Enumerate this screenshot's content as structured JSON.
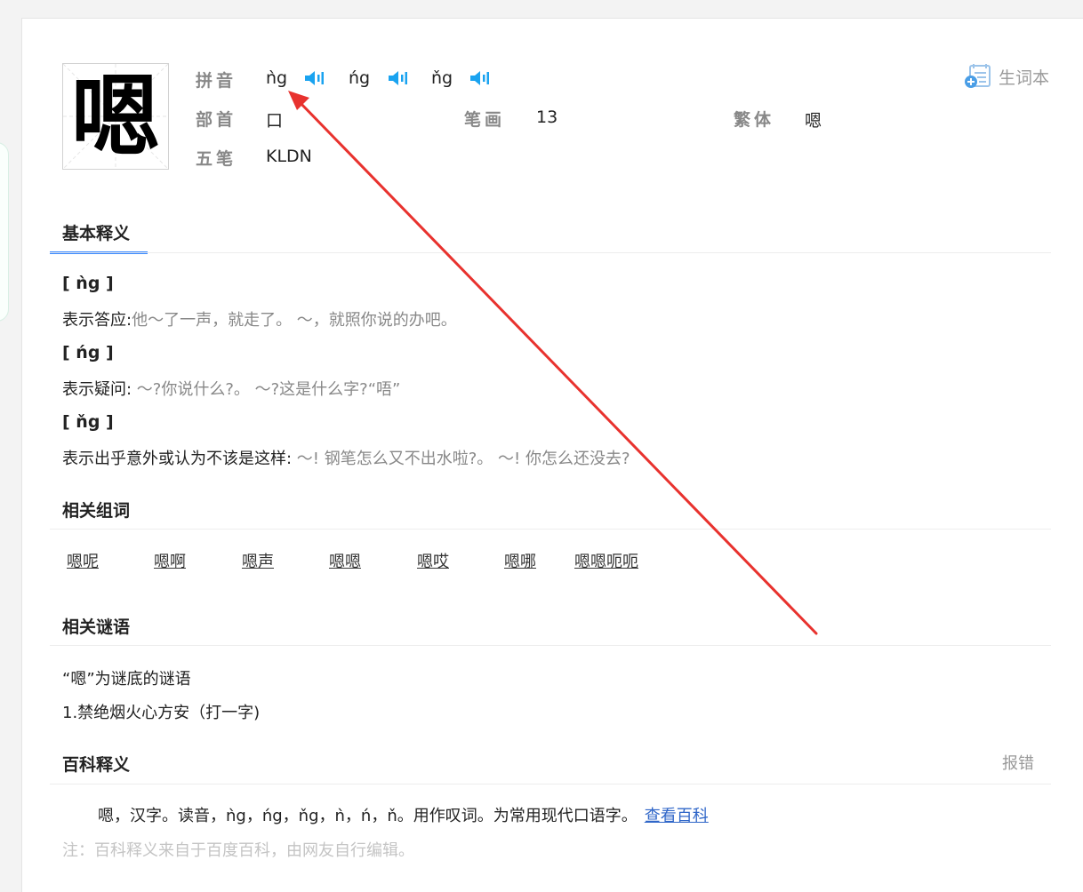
{
  "character": {
    "glyph": "嗯",
    "pinyin_label": "拼音",
    "readings": [
      {
        "text": "ǹg"
      },
      {
        "text": "ńg"
      },
      {
        "text": "ňg"
      }
    ],
    "radical_label": "部首",
    "radical": "口",
    "strokes_label": "笔画",
    "strokes": "13",
    "traditional_label": "繁体",
    "traditional": "嗯",
    "wubi_label": "五笔",
    "wubi": "KLDN",
    "vocab_label": "生词本"
  },
  "basic": {
    "title": "基本释义",
    "entries": [
      {
        "pinyin": "[ ǹg ]",
        "meaning": "表示答应:",
        "examples": "他～了一声，就走了。 ～，就照你说的办吧。"
      },
      {
        "pinyin": "[ ńg ]",
        "meaning": "表示疑问:",
        "examples": " ～?你说什么?。 ～?这是什么字?“唔”"
      },
      {
        "pinyin": "[ ňg ]",
        "meaning": "表示出乎意外或认为不该是这样:",
        "examples": " ～! 钢笔怎么又不出水啦?。 ～! 你怎么还没去?"
      }
    ]
  },
  "related_words": {
    "title": "相关组词",
    "words": [
      "嗯呢",
      "嗯啊",
      "嗯声",
      "嗯嗯",
      "嗯哎",
      "嗯哪",
      "嗯嗯呃呃"
    ]
  },
  "riddles": {
    "title": "相关谜语",
    "intro": "“嗯”为谜底的谜语",
    "items": [
      "1.禁绝烟火心方安（打一字)"
    ]
  },
  "baike": {
    "title": "百科释义",
    "report": "报错",
    "text": "嗯，汉字。读音，ǹg，ńg，ňg，ǹ，ń，ň。用作叹词。为常用现代口语字。",
    "link": "查看百科",
    "note": "注：百科释义来自于百度百科，由网友自行编辑。"
  },
  "colors": {
    "accent": "#3385ff",
    "speaker": "#1aa3f0",
    "arrow": "#e8322e"
  }
}
